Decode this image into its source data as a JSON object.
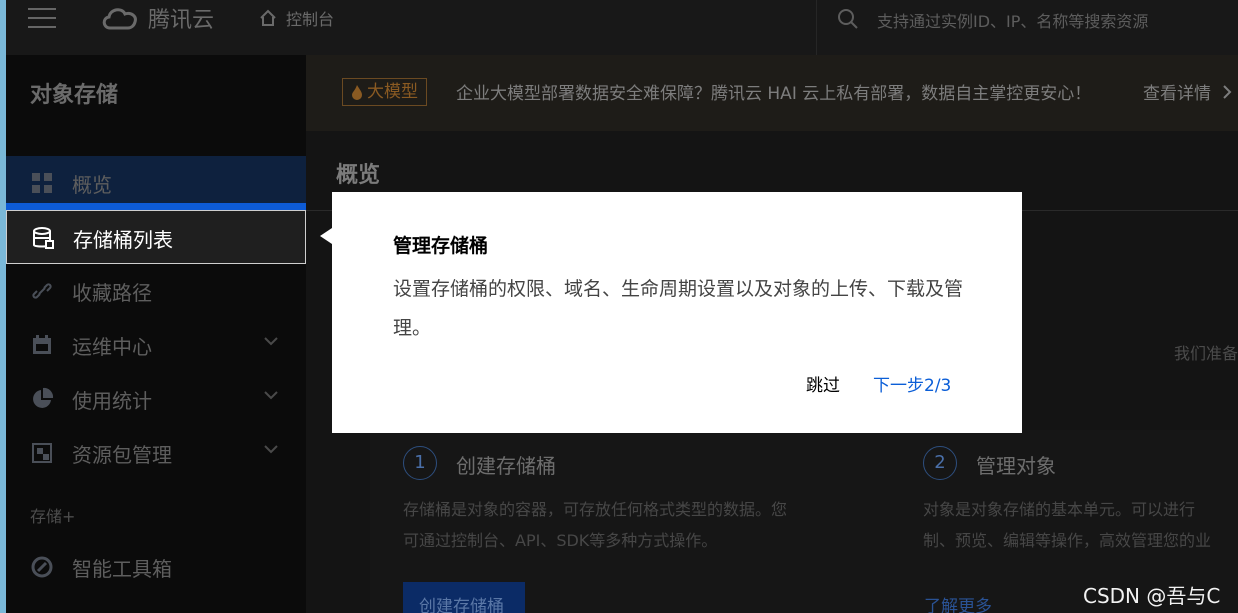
{
  "topbar": {
    "brand": "腾讯云",
    "console_link": "控制台",
    "search_placeholder": "支持通过实例ID、IP、名称等搜索资源"
  },
  "sidebar": {
    "title": "对象存储",
    "items": [
      {
        "label": "概览",
        "icon": "grid-icon"
      },
      {
        "label": "存储桶列表",
        "icon": "bucket-icon"
      },
      {
        "label": "收藏路径",
        "icon": "link-icon"
      },
      {
        "label": "运维中心",
        "icon": "calendar-icon",
        "expandable": true
      },
      {
        "label": "使用统计",
        "icon": "pie-chart-icon",
        "expandable": true
      },
      {
        "label": "资源包管理",
        "icon": "package-icon",
        "expandable": true
      }
    ],
    "section_label": "存储+",
    "section_items": [
      {
        "label": "智能工具箱",
        "icon": "tools-icon"
      }
    ]
  },
  "notice": {
    "tag": "大模型",
    "text": "企业大模型部署数据安全难保障？腾讯云 HAI 云上私有部署，数据自主掌控更安心！",
    "link": "查看详情"
  },
  "main": {
    "title": "概览",
    "prep_text": "我们准备",
    "steps": [
      {
        "number": "1",
        "title": "创建存储桶",
        "desc_line1": "存储桶是对象的容器，可存放任何格式类型的数据。您",
        "desc_line2": "可通过控制台、API、SDK等多种方式操作。",
        "button": "创建存储桶"
      },
      {
        "number": "2",
        "title": "管理对象",
        "desc_line1": "对象是对象存储的基本单元。可以进行",
        "desc_line2": "制、预览、编辑等操作，高效管理您的业",
        "link": "了解更多"
      }
    ]
  },
  "popover": {
    "title": "管理存储桶",
    "body": "设置存储桶的权限、域名、生命周期设置以及对象的上传、下载及管理。",
    "skip": "跳过",
    "next": "下一步2/3"
  },
  "watermark": "CSDN @吾与C"
}
